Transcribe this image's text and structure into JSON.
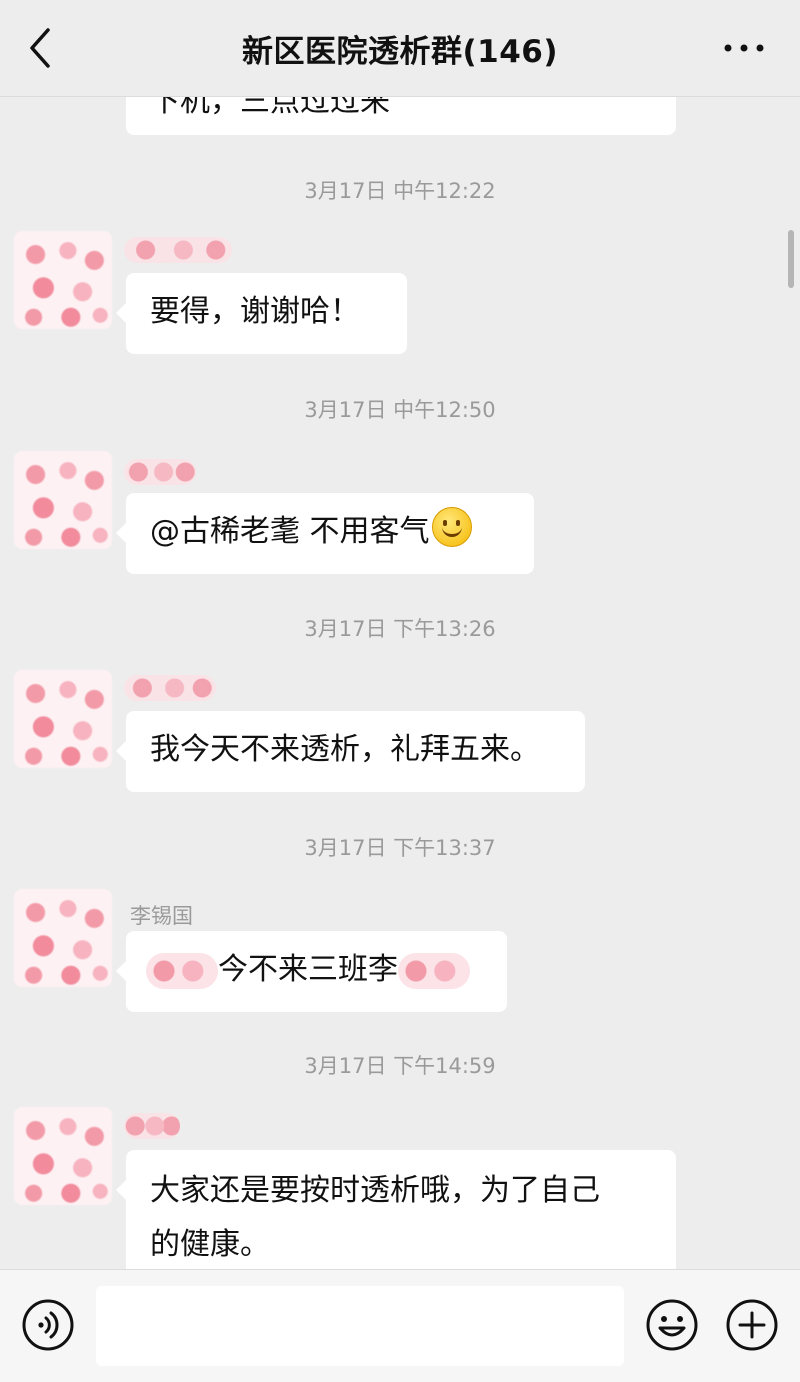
{
  "header": {
    "title": "新区医院透析群(146)"
  },
  "messages": [
    {
      "text": "下机，三点过过来"
    },
    {
      "time": "3月17日 中午12:22",
      "text": "要得，谢谢哈！"
    },
    {
      "time": "3月17日 中午12:50",
      "text": "@古稀老耄  不用客气"
    },
    {
      "time": "3月17日 下午13:26",
      "text": "我今天不来透析，礼拜五来。"
    },
    {
      "time": "3月17日 下午13:37",
      "sender": "李锡国",
      "text": "今不来三班李"
    },
    {
      "time": "3月17日 下午14:59",
      "text_line1": "大家还是要按时透析哦，为了自己",
      "text_line2": "的健康。"
    }
  ],
  "icons": {
    "back": "chevron-left-icon",
    "more": "more-dots-icon",
    "voice": "voice-icon",
    "emoji": "emoji-icon",
    "plus": "plus-icon",
    "smile": "smile-emoji"
  }
}
